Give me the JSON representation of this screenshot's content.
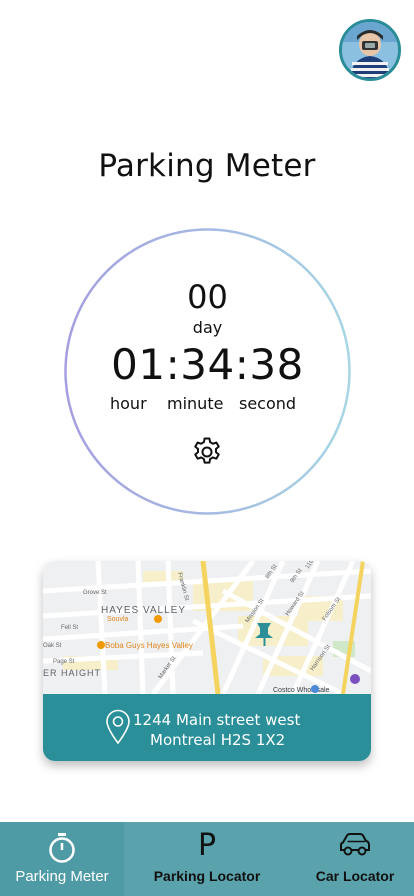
{
  "page": {
    "title": "Parking Meter"
  },
  "timer": {
    "days": "00",
    "days_label": "day",
    "time": "01:34:38",
    "hour_label": "hour",
    "minute_label": "minute",
    "second_label": "second"
  },
  "map": {
    "labels": {
      "hayes_valley": "HAYES VALLEY",
      "boba": "Boba Guys Hayes Valley",
      "souvla": "Souvla",
      "costco": "Costco Wholesale",
      "haight": "ER HAIGHT",
      "franklin": "Franklin St",
      "grove": "Grove St",
      "fell": "Fell St",
      "oak": "Oak St",
      "page_st": "Page St",
      "market": "Market St",
      "mission": "Mission St",
      "howard": "Howard St",
      "folsom": "Folsom St",
      "harrison": "Harrison St",
      "eighth": "8th St",
      "ninth": "9th St",
      "eleventh": "11th St"
    },
    "address_line1": "1244 Main street west",
    "address_line2": "Montreal H2S 1X2"
  },
  "nav": {
    "items": [
      {
        "label": "Parking Meter",
        "icon": "stopwatch-icon",
        "active": true
      },
      {
        "label": "Parking Locator",
        "icon": "parking-p-icon",
        "active": false
      },
      {
        "label": "Car Locator",
        "icon": "car-icon",
        "active": false
      }
    ],
    "p_glyph": "P"
  },
  "colors": {
    "accent": "#2a8f99",
    "nav_bg": "#5aa3ac",
    "ring_start": "#a59ee0",
    "ring_end": "#a6d6e4"
  }
}
